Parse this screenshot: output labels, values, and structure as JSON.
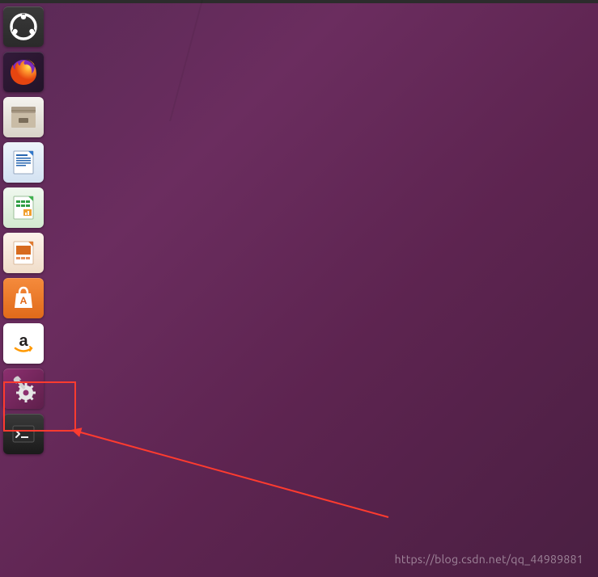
{
  "launcher": {
    "items": [
      {
        "name": "dash",
        "icon": "ubuntu-logo-icon"
      },
      {
        "name": "firefox",
        "icon": "firefox-icon"
      },
      {
        "name": "files",
        "icon": "files-icon"
      },
      {
        "name": "writer",
        "icon": "libreoffice-writer-icon"
      },
      {
        "name": "calc",
        "icon": "libreoffice-calc-icon"
      },
      {
        "name": "impress",
        "icon": "libreoffice-impress-icon"
      },
      {
        "name": "software-center",
        "icon": "shopping-bag-icon"
      },
      {
        "name": "amazon",
        "icon": "amazon-icon"
      },
      {
        "name": "system-settings",
        "icon": "gear-wrench-icon"
      },
      {
        "name": "terminal",
        "icon": "terminal-icon"
      }
    ]
  },
  "annotation": {
    "highlight_target": "system-settings",
    "highlight_color": "#ff3b2f"
  },
  "watermark": "https://blog.csdn.net/qq_44989881"
}
